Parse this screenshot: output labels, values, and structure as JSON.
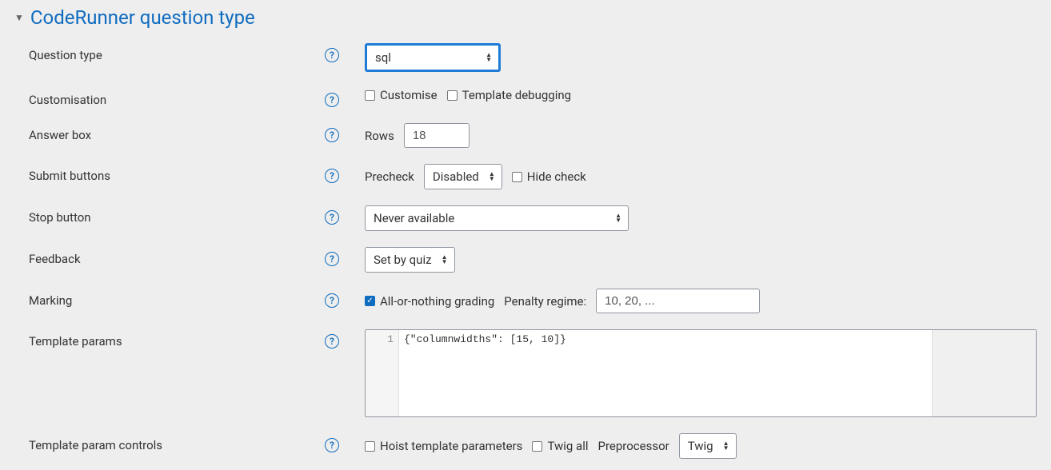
{
  "section": {
    "title": "CodeRunner question type"
  },
  "labels": {
    "question_type": "Question type",
    "customisation": "Customisation",
    "answer_box": "Answer box",
    "submit_buttons": "Submit buttons",
    "stop_button": "Stop button",
    "feedback": "Feedback",
    "marking": "Marking",
    "template_params": "Template params",
    "template_param_controls": "Template param controls"
  },
  "question_type_select": "sql",
  "customise_label": "Customise",
  "template_debugging_label": "Template debugging",
  "rows_label": "Rows",
  "rows_value": "18",
  "precheck_label": "Precheck",
  "precheck_value": "Disabled",
  "hide_check_label": "Hide check",
  "stop_button_value": "Never available",
  "feedback_value": "Set by quiz",
  "all_or_nothing_label": "All-or-nothing grading",
  "penalty_regime_label": "Penalty regime:",
  "penalty_regime_value": "10, 20, ...",
  "template_params_line_no": "1",
  "template_params_code": "{\"columnwidths\": [15, 10]}",
  "hoist_label": "Hoist template parameters",
  "twig_all_label": "Twig all",
  "preprocessor_label": "Preprocessor",
  "preprocessor_value": "Twig",
  "chart_data": null
}
